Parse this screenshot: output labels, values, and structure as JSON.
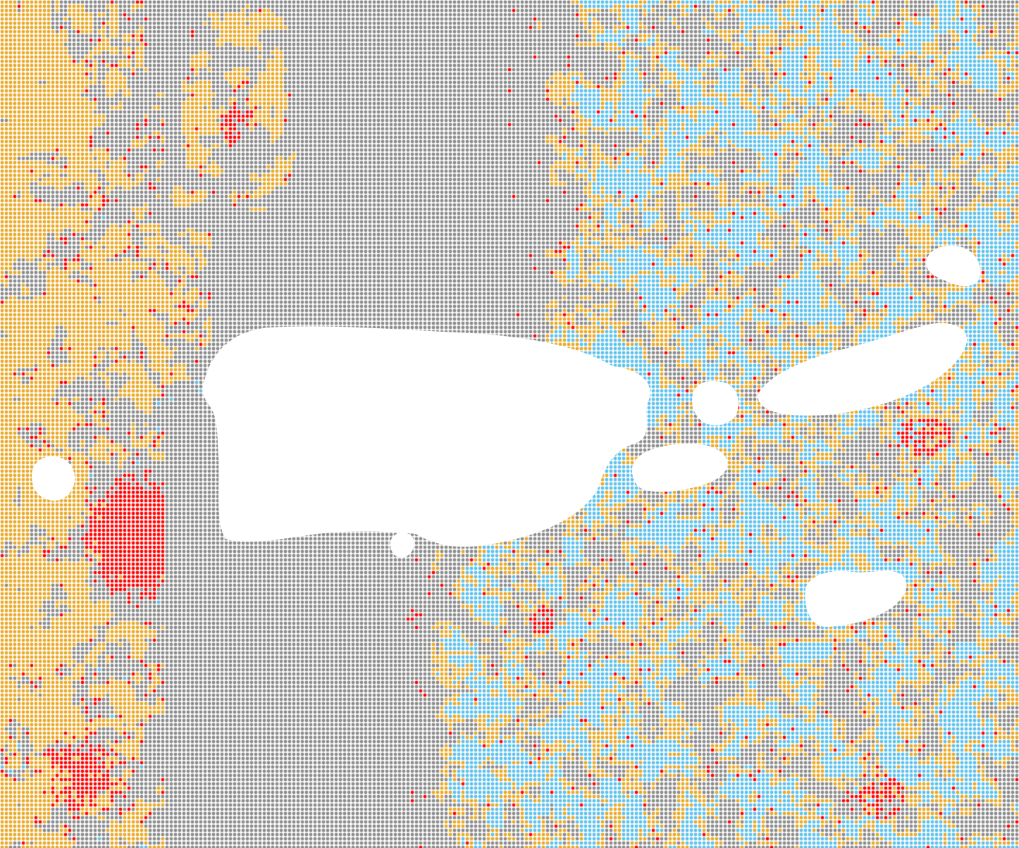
{
  "map": {
    "palette": {
      "background_dot": "#8a8a8a",
      "low": "#5bc0eb",
      "medium": "#e8a825",
      "high": "#ff0000",
      "land": "#ffffff"
    },
    "land_icon": "island-shape",
    "grid_icon": "dot-grid"
  }
}
